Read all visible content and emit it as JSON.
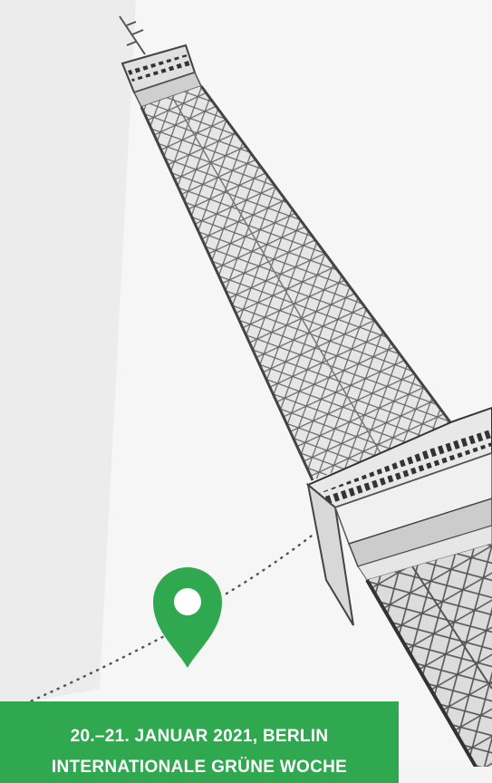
{
  "banner": {
    "date_location": "20.–21. JANUAR 2021, BERLIN",
    "venue": "INTERNATIONALE GRÜNE WOCHE"
  },
  "colors": {
    "accent_green": "#2fa84f",
    "background": "#f4f4f4",
    "tower": "#555555"
  },
  "icons": {
    "location": "location-pin-icon"
  }
}
